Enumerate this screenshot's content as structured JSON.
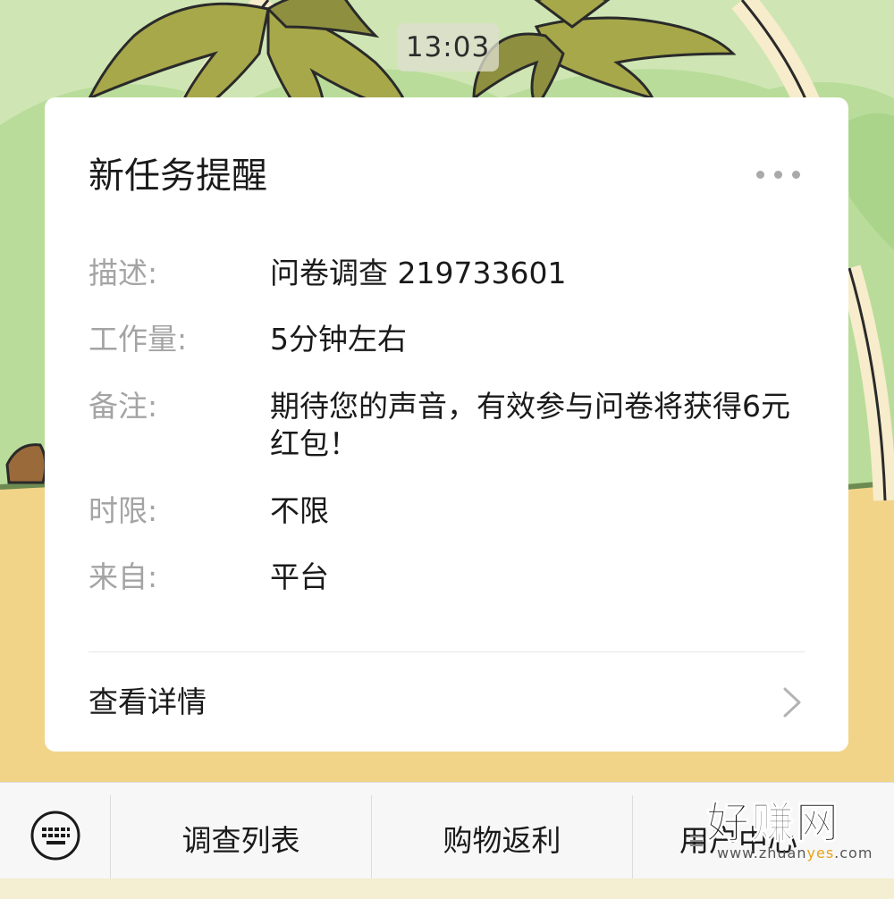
{
  "status": {
    "time": "13:03"
  },
  "card": {
    "title": "新任务提醒",
    "fields": [
      {
        "label": "描述:",
        "value": "问卷调查 219733601"
      },
      {
        "label": "工作量:",
        "value": "5分钟左右"
      },
      {
        "label": "备注:",
        "value": "期待您的声音，有效参与问卷将获得6元红包！"
      },
      {
        "label": "时限:",
        "value": "不限"
      },
      {
        "label": "来自:",
        "value": "平台"
      }
    ],
    "details_label": "查看详情"
  },
  "menu": {
    "items": [
      {
        "label": "调查列表"
      },
      {
        "label": "购物返利"
      },
      {
        "label": "用户中心"
      }
    ]
  },
  "watermark": {
    "brand": "好赚网",
    "domain_prefix": "www.zhuan",
    "domain_highlight": "yes",
    "domain_suffix": ".com"
  },
  "colors": {
    "sky": "#cfe6b4",
    "sand": "#f2d488",
    "card_bg": "#ffffff",
    "label_gray": "#a4a4a4",
    "menubar_bg": "#f7f7f7"
  },
  "icons": {
    "more": "more-dots-icon",
    "chevron": "chevron-right-icon",
    "keyboard": "keyboard-icon",
    "submenu": "submenu-lines-icon"
  }
}
